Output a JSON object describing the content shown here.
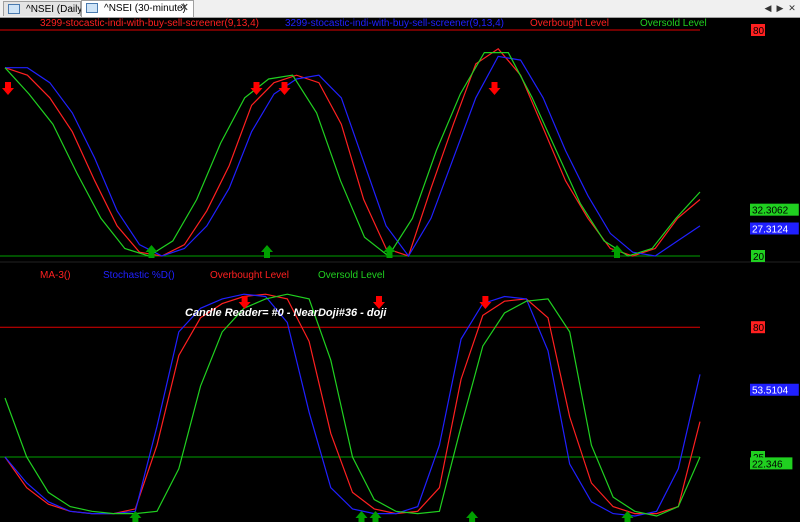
{
  "tabs": [
    {
      "label": "^NSEI (Daily)",
      "active": false
    },
    {
      "label": "^NSEI (30-minute)",
      "active": true
    }
  ],
  "nav": {
    "prev": "◀",
    "next": "▶",
    "close": "✕"
  },
  "colors": {
    "red": "#ff2020",
    "blue": "#2020ff",
    "green": "#20d020",
    "level_green": "#00a000",
    "arrow_red": "#ff0000",
    "arrow_green": "#00a000"
  },
  "chart_data": [
    {
      "type": "line",
      "panel": "upper",
      "legend": [
        {
          "text": "3299-stocastic-indi-with-buy-sell-screener(9,13,4)",
          "color": "#ff2020"
        },
        {
          "text": "3299-stocastic-indi-with-buy-sell-screener(9,13,4)",
          "color": "#2020ff"
        },
        {
          "text": "Overbought Level",
          "color": "#ff2020"
        },
        {
          "text": "Oversold Level",
          "color": "#20d020"
        }
      ],
      "ylim": [
        20,
        80
      ],
      "levels": [
        {
          "value": 80,
          "label": "80",
          "color": "#ff2020"
        },
        {
          "value": 20,
          "label": "20",
          "color": "#20d020"
        }
      ],
      "value_labels": [
        {
          "text": "32.3062",
          "value": 32.3,
          "color": "#20d020"
        },
        {
          "text": "27.3124",
          "value": 27.3,
          "color": "#2020ff"
        }
      ],
      "x": [
        0,
        4,
        8,
        12,
        16,
        20,
        24,
        28,
        32,
        36,
        40,
        44,
        48,
        52,
        56,
        60,
        64,
        68,
        72,
        76,
        80,
        84,
        88,
        92,
        96,
        100
      ],
      "series": [
        {
          "color": "#ff2020",
          "values": [
            70,
            68,
            62,
            53,
            40,
            28,
            21,
            20,
            23,
            32,
            44,
            60,
            66,
            68,
            66,
            55,
            35,
            22,
            20,
            38,
            55,
            71,
            75,
            68,
            54,
            40,
            30,
            22,
            20,
            22,
            30,
            35
          ]
        },
        {
          "color": "#2020ff",
          "values": [
            70,
            70,
            66,
            58,
            46,
            32,
            23,
            20,
            22,
            28,
            38,
            53,
            63,
            67,
            68,
            62,
            45,
            28,
            20,
            30,
            46,
            62,
            73,
            72,
            62,
            48,
            36,
            26,
            21,
            20,
            24,
            28
          ]
        },
        {
          "color": "#20d020",
          "values": [
            70,
            63,
            55,
            42,
            30,
            22,
            20,
            24,
            35,
            50,
            62,
            67,
            68,
            58,
            40,
            25,
            20,
            30,
            48,
            63,
            74,
            74,
            62,
            48,
            34,
            24,
            20,
            22,
            30,
            37
          ]
        }
      ],
      "sell_arrows": [
        0,
        35.5,
        39.5,
        69.5
      ],
      "buy_arrows": [
        20.5,
        37,
        54.5,
        87
      ]
    },
    {
      "type": "line",
      "panel": "lower",
      "legend": [
        {
          "text": "MA-3()",
          "color": "#ff2020"
        },
        {
          "text": "Stochastic %D()",
          "color": "#2020ff"
        },
        {
          "text": "Overbought Level",
          "color": "#ff2020"
        },
        {
          "text": "Oversold Level",
          "color": "#20d020"
        }
      ],
      "ylim": [
        0,
        100
      ],
      "levels": [
        {
          "value": 80,
          "label": "80",
          "color": "#ff2020"
        },
        {
          "value": 25,
          "label": "25",
          "color": "#20d020"
        }
      ],
      "value_labels": [
        {
          "text": "53.5104",
          "value": 53.5,
          "color": "#2020ff"
        },
        {
          "text": "22.346",
          "value": 22.3,
          "color": "#20d020"
        }
      ],
      "annotation": "Candle Reader= #0 - NearDoji#36 - doji",
      "series": [
        {
          "color": "#ff2020",
          "values": [
            25,
            12,
            5,
            2,
            1,
            1,
            3,
            30,
            68,
            84,
            90,
            93,
            94,
            92,
            74,
            35,
            10,
            3,
            1,
            2,
            12,
            58,
            85,
            91,
            92,
            84,
            42,
            14,
            4,
            1,
            1,
            4,
            40
          ]
        },
        {
          "color": "#2020ff",
          "values": [
            25,
            14,
            6,
            2,
            1,
            1,
            2,
            38,
            78,
            88,
            92,
            94,
            93,
            82,
            44,
            12,
            3,
            1,
            1,
            4,
            30,
            75,
            90,
            93,
            92,
            70,
            22,
            6,
            1,
            0,
            2,
            20,
            60
          ]
        },
        {
          "color": "#20d020",
          "values": [
            50,
            25,
            10,
            4,
            2,
            1,
            1,
            2,
            20,
            55,
            78,
            88,
            92,
            94,
            92,
            66,
            25,
            7,
            2,
            1,
            2,
            38,
            72,
            86,
            91,
            92,
            78,
            30,
            8,
            2,
            0,
            4,
            25
          ]
        }
      ],
      "sell_arrows": [
        33.8,
        53,
        68.2
      ],
      "buy_arrows": [
        18.2,
        50.5,
        52.5,
        66.3,
        88.5
      ]
    }
  ]
}
